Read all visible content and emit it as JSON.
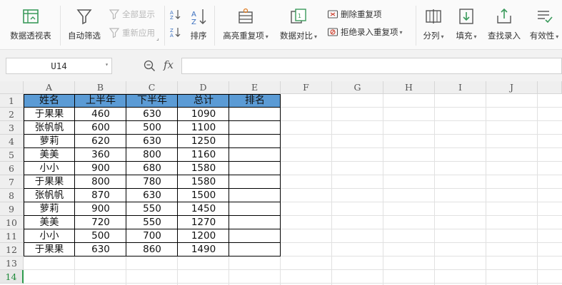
{
  "ribbon": {
    "pivot_label": "数据透视表",
    "autofilter_label": "自动筛选",
    "show_all_label": "全部显示",
    "reapply_label": "重新应用",
    "sort_label": "排序",
    "highlight_dup_label": "高亮重复项",
    "compare_label": "数据对比",
    "remove_dup_label": "删除重复项",
    "reject_dup_label": "拒绝录入重复项",
    "split_col_label": "分列",
    "fill_label": "填充",
    "find_enter_label": "查找录入",
    "validity_label": "有效性"
  },
  "formula_bar": {
    "name_box": "U14",
    "fx_symbol": "fx",
    "formula": ""
  },
  "sheet": {
    "columns": [
      "A",
      "B",
      "C",
      "D",
      "E",
      "F",
      "G",
      "H",
      "I",
      "J"
    ],
    "rows": [
      "1",
      "2",
      "3",
      "4",
      "5",
      "6",
      "7",
      "8",
      "9",
      "10",
      "11",
      "12",
      "13",
      "14"
    ],
    "active_row": "14",
    "header_fill": "#5b9bd5",
    "headers": [
      "姓名",
      "上半年",
      "下半年",
      "总计",
      "排名"
    ],
    "data": [
      [
        "于果果",
        "460",
        "630",
        "1090",
        ""
      ],
      [
        "张帆帆",
        "600",
        "500",
        "1100",
        ""
      ],
      [
        "萝莉",
        "620",
        "630",
        "1250",
        ""
      ],
      [
        "美美",
        "360",
        "800",
        "1160",
        ""
      ],
      [
        "小小",
        "900",
        "680",
        "1580",
        ""
      ],
      [
        "于果果",
        "800",
        "780",
        "1580",
        ""
      ],
      [
        "张帆帆",
        "870",
        "630",
        "1500",
        ""
      ],
      [
        "萝莉",
        "900",
        "550",
        "1450",
        ""
      ],
      [
        "美美",
        "720",
        "550",
        "1270",
        ""
      ],
      [
        "小小",
        "500",
        "700",
        "1200",
        ""
      ],
      [
        "于果果",
        "630",
        "860",
        "1490",
        ""
      ]
    ]
  }
}
